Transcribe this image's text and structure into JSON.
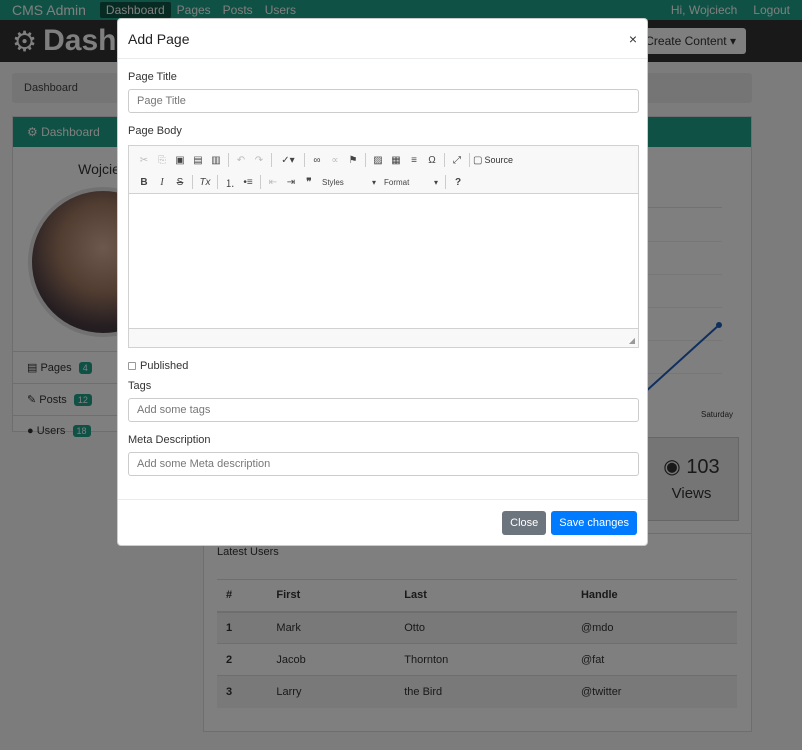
{
  "nav": {
    "brand": "CMS Admin",
    "links": [
      "Dashboard",
      "Pages",
      "Posts",
      "Users"
    ],
    "greeting": "Hi, Wojciech",
    "logout": "Logout"
  },
  "header": {
    "title": "Dashb",
    "create_button": "Create Content ▾"
  },
  "breadcrumb": "Dashboard",
  "sidebar": {
    "panel_title": "Dashboard",
    "user_name": "Wojciec",
    "items": [
      {
        "label": "Pages",
        "count": "4"
      },
      {
        "label": "Posts",
        "count": "12"
      },
      {
        "label": "Users",
        "count": "18"
      }
    ]
  },
  "main": {
    "chart_day": "Saturday",
    "views_count": "103",
    "views_label": "Views",
    "latest_users_title": "Latest Users",
    "table": {
      "headers": [
        "#",
        "First",
        "Last",
        "Handle"
      ],
      "rows": [
        [
          "1",
          "Mark",
          "Otto",
          "@mdo"
        ],
        [
          "2",
          "Jacob",
          "Thornton",
          "@fat"
        ],
        [
          "3",
          "Larry",
          "the Bird",
          "@twitter"
        ]
      ]
    }
  },
  "modal": {
    "title": "Add Page",
    "close_icon": "×",
    "page_title_label": "Page Title",
    "page_title_placeholder": "Page Title",
    "page_body_label": "Page Body",
    "editor": {
      "source_label": "Source",
      "styles_label": "Styles",
      "format_label": "Format"
    },
    "published_label": "Published",
    "tags_label": "Tags",
    "tags_placeholder": "Add some tags",
    "meta_label": "Meta Description",
    "meta_placeholder": "Add some Meta description",
    "close_button": "Close",
    "save_button": "Save changes"
  },
  "colors": {
    "accent": "#1ea38a",
    "header_bg": "#333333",
    "primary": "#007bff",
    "secondary": "#6c757d"
  }
}
